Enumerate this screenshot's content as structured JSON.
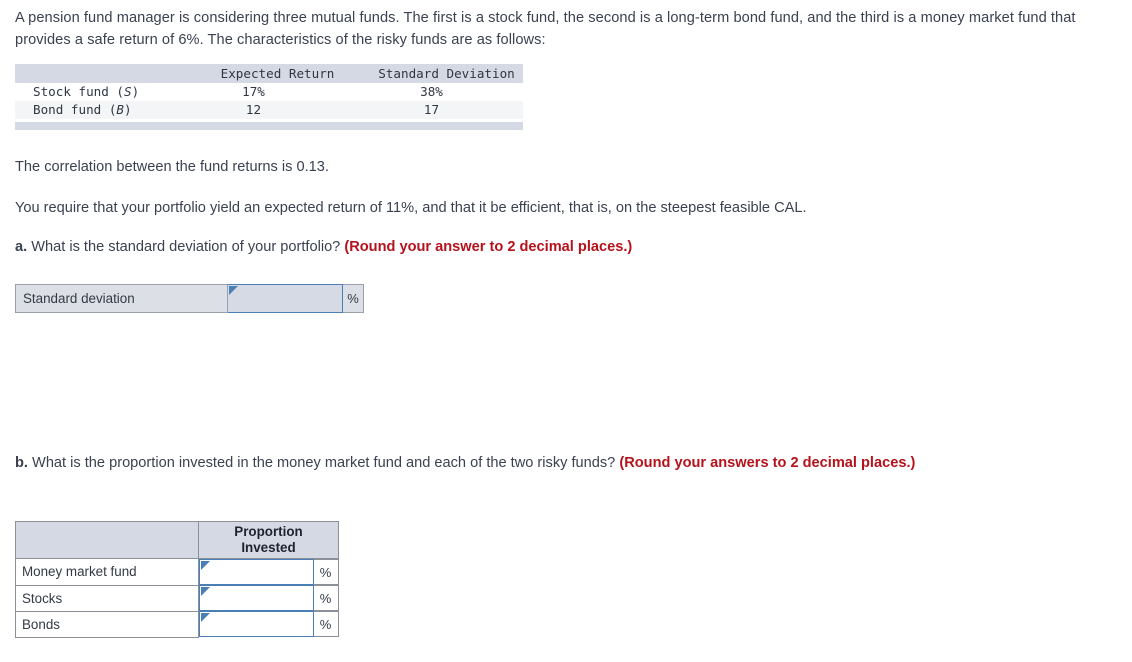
{
  "intro": {
    "text": "A pension fund manager is considering three mutual funds. The first is a stock fund, the second is a long-term bond fund, and the third is a money market fund that provides a safe return of 6%. The characteristics of the risky funds are as follows:"
  },
  "fund_table": {
    "headers": [
      "",
      "Expected Return",
      "Standard Deviation"
    ],
    "rows": [
      {
        "label": "Stock fund (",
        "symbol": "S",
        "label_end": ")",
        "expected_return": "17%",
        "standard_deviation": "38%"
      },
      {
        "label": "Bond fund (",
        "symbol": "B",
        "label_end": ")",
        "expected_return": "12",
        "standard_deviation": "17"
      }
    ]
  },
  "statements": {
    "correlation": "The correlation between the fund returns is 0.13.",
    "requirement": "You require that your portfolio yield an expected return of 11%, and that it be efficient, that is, on the steepest feasible CAL."
  },
  "question_a": {
    "letter": "a.",
    "text": " What is the standard deviation of your portfolio? ",
    "note": "(Round your answer to 2 decimal places.)",
    "answer_row": {
      "label": "Standard deviation",
      "value": "",
      "unit": "%"
    }
  },
  "question_b": {
    "letter": "b.",
    "text": " What is the proportion invested in the money market fund and each of the two risky funds? ",
    "note": "(Round your answers to 2 decimal places.)",
    "table": {
      "header_blank": "",
      "header_proportion_line1": "Proportion",
      "header_proportion_line2": "Invested",
      "rows": [
        {
          "label": "Money market fund",
          "value": "",
          "unit": "%"
        },
        {
          "label": "Stocks",
          "value": "",
          "unit": "%"
        },
        {
          "label": "Bonds",
          "value": "",
          "unit": "%"
        }
      ]
    }
  },
  "colors": {
    "text": "#3a4150",
    "note_red": "#b5121b",
    "header_bg": "#d4d9e4",
    "input_border": "#4a7fb5",
    "answer_bar_bg": "#dcdfe6"
  }
}
